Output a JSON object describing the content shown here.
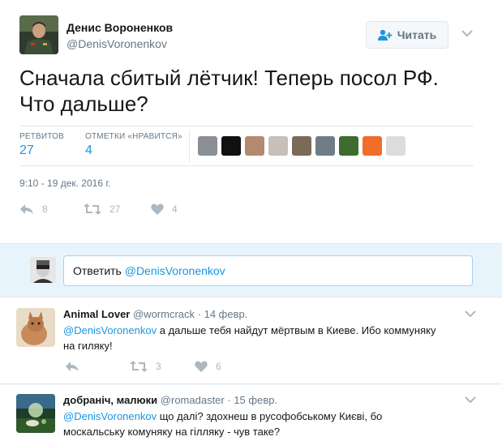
{
  "author": {
    "name": "Денис Вороненков",
    "handle": "@DenisVoronenkov"
  },
  "follow_label": "Читать",
  "tweet_text_line1": "Сначала сбитый лётчик! Теперь посол РФ.",
  "tweet_text_line2": "Что дальше?",
  "stats": {
    "retweets_label": "РЕТВИТОВ",
    "retweets_value": "27",
    "likes_label": "ОТМЕТКИ «НРАВИТСЯ»",
    "likes_value": "4"
  },
  "timestamp": "9:10 - 19 дек. 2016 г.",
  "actions": {
    "reply_count": "8",
    "retweet_count": "27",
    "like_count": "4"
  },
  "reply_box": {
    "prefix": "Ответить ",
    "mention": "@DenisVoronenkov"
  },
  "comments": [
    {
      "name": "Animal Lover",
      "handle": "@wormcrack",
      "date": "14 февр.",
      "mention": "@DenisVoronenkov",
      "text_line1": " а дальше тебя найдут мёртвым в Киеве. Ибо коммуняку",
      "text_line2": "на гиляку!",
      "retweet_count": "3",
      "like_count": "6"
    },
    {
      "name": "добраніч, малюки",
      "handle": "@romadaster",
      "date": "15 февр.",
      "mention": "@DenisVoronenkov",
      "text_line1": " що далі? здохнеш в русофобському Києві, бо",
      "text_line2": "москальську комуняку на гілляку - чув таке?"
    }
  ],
  "colors": {
    "link": "#1b95e0",
    "muted": "#657786",
    "icon": "#aab8c2"
  }
}
